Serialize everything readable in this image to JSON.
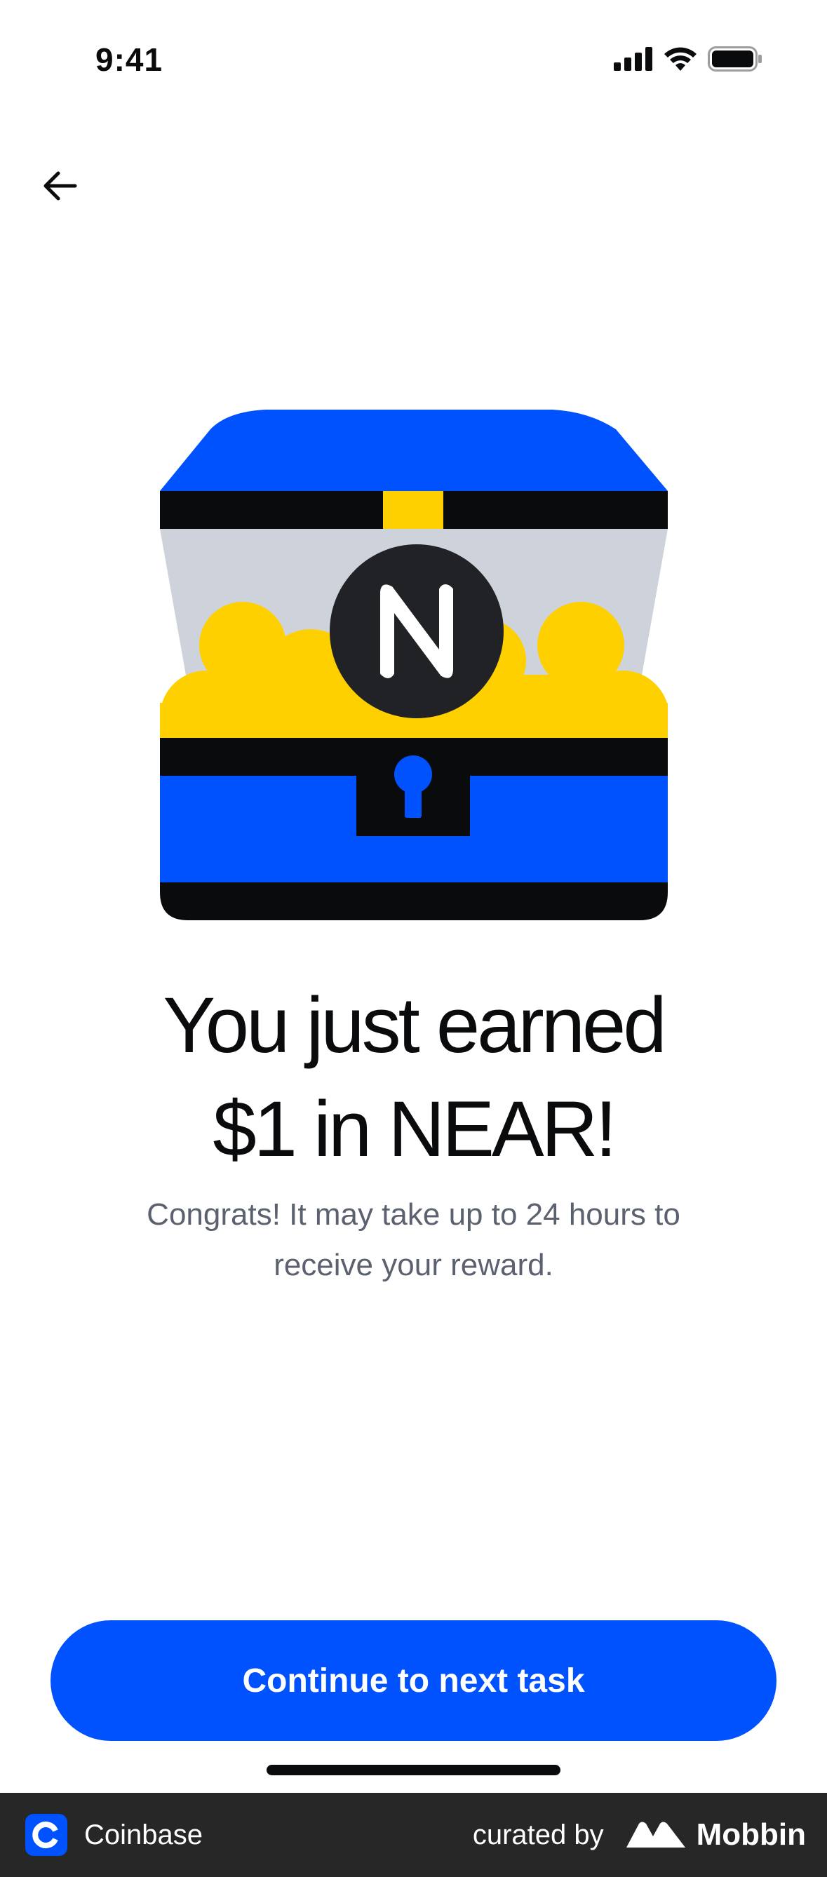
{
  "status_bar": {
    "time": "9:41"
  },
  "header": {
    "back_icon": "arrow-left-icon"
  },
  "illustration": {
    "name": "treasure-chest",
    "coin_icon": "near-logo-icon",
    "colors": {
      "blue": "#0052FF",
      "black": "#0A0B0D",
      "yellow": "#FFD000",
      "grey": "#CED2DB",
      "coin": "#202225"
    }
  },
  "content": {
    "headline_line1": "You just earned",
    "headline_line2": "$1 in NEAR!",
    "subtext_line1": "Congrats! It may take up to 24 hours to",
    "subtext_line2": "receive your reward."
  },
  "cta": {
    "label": "Continue to next task",
    "color": "#0052FF"
  },
  "footer": {
    "app_name": "Coinbase",
    "curated_by": "curated by",
    "brand": "Mobbin"
  }
}
